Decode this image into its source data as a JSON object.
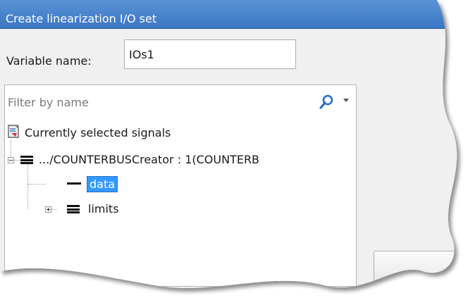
{
  "dialog": {
    "title": "Create linearization I/O set"
  },
  "variable": {
    "label": "Variable name:",
    "value": "IOs1"
  },
  "filter": {
    "placeholder": "Filter by name",
    "icon": "search-icon"
  },
  "tree": {
    "root": {
      "label": "Currently selected signals",
      "icon": "signal-list-icon"
    },
    "items": [
      {
        "label": ".../COUNTERBUSCreator : 1(COUNTERB",
        "icon": "bus-icon",
        "expanded": true
      },
      {
        "label": "data",
        "icon": "signal-icon",
        "selected": true
      },
      {
        "label": "limits",
        "icon": "bus-icon",
        "expanded": false
      }
    ]
  },
  "colors": {
    "title_bar": "#3a76c4",
    "selection": "#3399ff",
    "background": "#f0f0f0"
  }
}
